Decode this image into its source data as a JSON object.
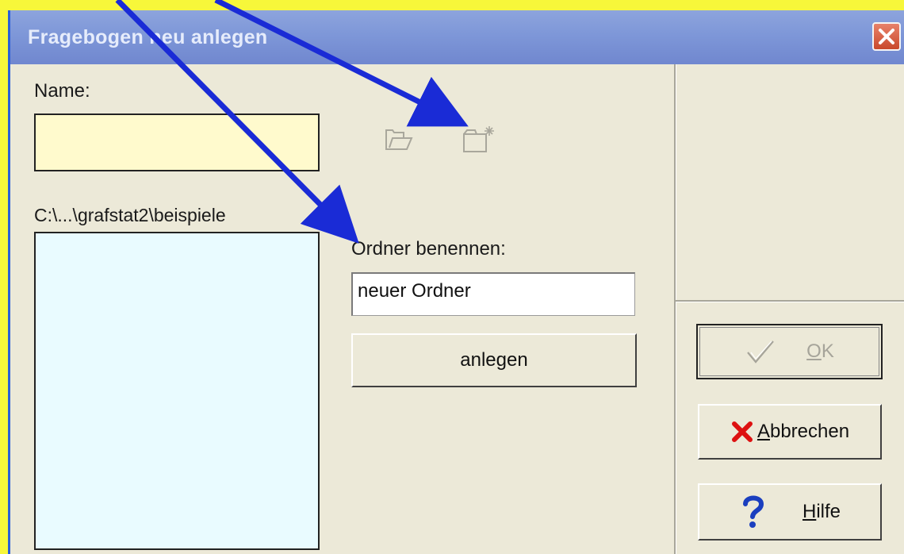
{
  "window": {
    "title": "Fragebogen neu anlegen",
    "close_icon": "close-icon"
  },
  "form": {
    "name_label": "Name:",
    "name_value": "",
    "path_label": "C:\\...\\grafstat2\\beispiele",
    "folder_label": "Ordner benennen:",
    "folder_value": "neuer Ordner",
    "create_button_label": "anlegen"
  },
  "toolbar": {
    "open_folder_icon": "open-folder-icon",
    "new_folder_icon": "new-folder-icon"
  },
  "buttons": {
    "ok_rest": "K",
    "ok_mnemonic": "O",
    "cancel_rest": "bbrechen",
    "cancel_mnemonic": "A",
    "help_rest": "ilfe",
    "help_mnemonic": "H"
  },
  "colors": {
    "background": "#f7f73a",
    "annotation_arrow": "#1a2bd6",
    "title_bar": "#7e97d8",
    "name_field": "#fffacd",
    "list_box": "#e9fbff"
  }
}
